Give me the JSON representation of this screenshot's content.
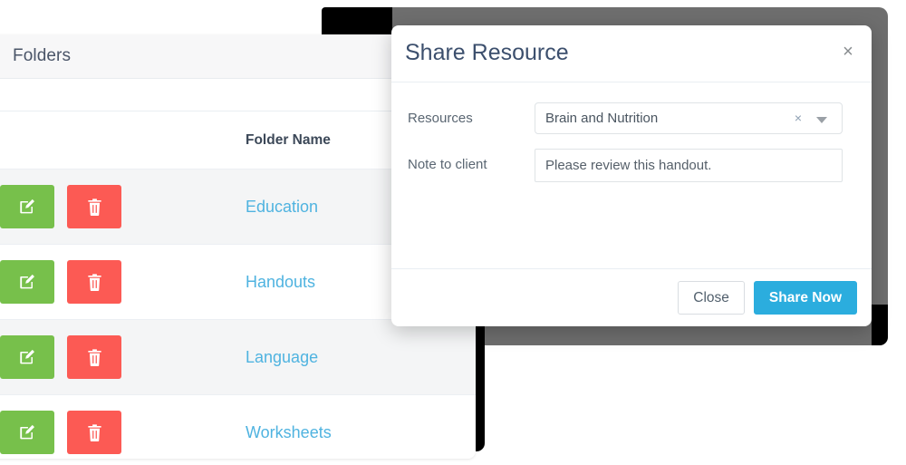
{
  "folders_panel": {
    "title": "Folders",
    "columns": {
      "actions": "",
      "folder_name": "Folder Name"
    },
    "rows": [
      {
        "name": "Education",
        "edit_label": "Edit",
        "delete_label": "Delete"
      },
      {
        "name": "Handouts",
        "edit_label": "Edit",
        "delete_label": "Delete"
      },
      {
        "name": "Language",
        "edit_label": "Edit",
        "delete_label": "Delete"
      },
      {
        "name": "Worksheets",
        "edit_label": "Edit",
        "delete_label": "Delete"
      }
    ]
  },
  "modal": {
    "title": "Share Resource",
    "close_symbol": "×",
    "fields": {
      "resources": {
        "label": "Resources",
        "value": "Brain and Nutrition",
        "clear_symbol": "×"
      },
      "note": {
        "label": "Note to client",
        "value": "Please review this handout.",
        "placeholder": ""
      }
    },
    "footer": {
      "close_label": "Close",
      "share_label": "Share Now"
    }
  },
  "colors": {
    "accent_blue": "#2badde",
    "link_blue": "#4fb3e0",
    "edit_green": "#77c04b",
    "delete_red": "#fc5a54",
    "header_text": "#3c4f6d"
  }
}
